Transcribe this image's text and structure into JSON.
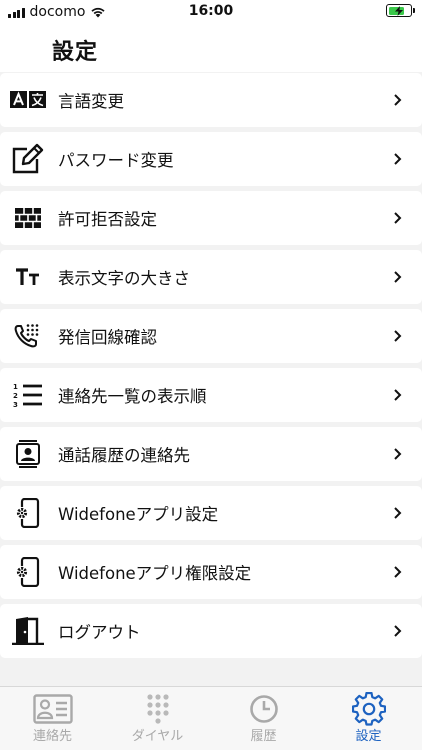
{
  "status_bar": {
    "carrier": "docomo",
    "time": "16:00",
    "signal_icon": "signal-bars-icon",
    "wifi_icon": "wifi-icon",
    "battery_icon": "battery-charging-icon"
  },
  "header": {
    "title": "設定"
  },
  "settings": [
    {
      "label": "言語変更",
      "icon": "language-icon"
    },
    {
      "label": "パスワード変更",
      "icon": "edit-pen-icon"
    },
    {
      "label": "許可拒否設定",
      "icon": "firewall-brick-icon"
    },
    {
      "label": "表示文字の大きさ",
      "icon": "text-size-icon"
    },
    {
      "label": "発信回線確認",
      "icon": "phone-dialpad-icon"
    },
    {
      "label": "連絡先一覧の表示順",
      "icon": "numbered-list-icon"
    },
    {
      "label": "通話履歴の連絡先",
      "icon": "contact-card-icon"
    },
    {
      "label": "Widefoneアプリ設定",
      "icon": "phone-gear-icon"
    },
    {
      "label": "Widefoneアプリ権限設定",
      "icon": "phone-gear-icon"
    },
    {
      "label": "ログアウト",
      "icon": "door-exit-icon"
    }
  ],
  "tabbar": {
    "active_color": "#1d62c0",
    "inactive_color": "#a9a9a9",
    "tabs": [
      {
        "label": "連絡先",
        "icon": "contacts-icon",
        "active": false
      },
      {
        "label": "ダイヤル",
        "icon": "dialpad-icon",
        "active": false
      },
      {
        "label": "履歴",
        "icon": "clock-icon",
        "active": false
      },
      {
        "label": "設定",
        "icon": "gear-icon",
        "active": true
      }
    ]
  }
}
